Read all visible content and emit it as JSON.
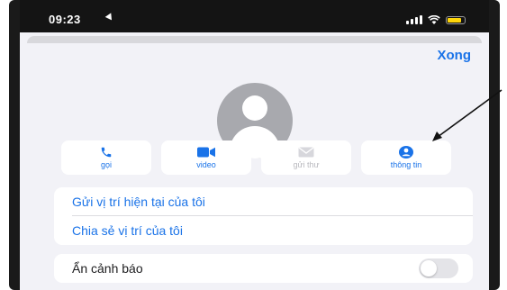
{
  "status_bar": {
    "time": "09:23",
    "battery_color": "#ffd60a"
  },
  "header": {
    "done_label": "Xong"
  },
  "contact": {
    "avatar_icon": "person-circle-icon"
  },
  "actions": [
    {
      "label": "gọi",
      "icon": "phone-icon",
      "enabled": true
    },
    {
      "label": "video",
      "icon": "video-camera-icon",
      "enabled": true
    },
    {
      "label": "gửi thư",
      "icon": "mail-icon",
      "enabled": false
    },
    {
      "label": "thông tin",
      "icon": "info-person-icon",
      "enabled": true
    }
  ],
  "location_group": {
    "send_current_location": "Gửi vị trí hiện tại của tôi",
    "share_location": "Chia sẻ vị trí của tôi"
  },
  "alerts_group": {
    "hide_alerts_label": "Ẩn cảnh báo",
    "hide_alerts_on": false
  },
  "colors": {
    "accent": "#1a73e8",
    "background": "#f2f2f7",
    "disabled": "#b9b9be"
  }
}
